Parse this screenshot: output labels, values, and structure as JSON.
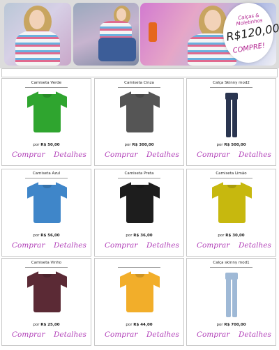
{
  "banner": {
    "promo_small": "Calças & Moletinhos",
    "promo_price": "R$120,00",
    "promo_cta": "COMPRE!"
  },
  "products": [
    {
      "name": "Camiseta Verde",
      "price_prefix": "por",
      "price": "R$ 50,00",
      "kind": "tshirt",
      "color": "#2fa52f",
      "buy_label": "Comprar",
      "details_label": "Detalhes"
    },
    {
      "name": "Camiseta Cinza",
      "price_prefix": "por",
      "price": "R$ 300,00",
      "kind": "tshirt",
      "color": "#555555",
      "buy_label": "Comprar",
      "details_label": "Detalhes"
    },
    {
      "name": "Calça Skinny mod2",
      "price_prefix": "por",
      "price": "R$ 500,00",
      "kind": "pants",
      "color": "#2a3550",
      "buy_label": "Comprar",
      "details_label": "Detalhes"
    },
    {
      "name": "Camiseta Azul",
      "price_prefix": "por",
      "price": "R$ 56,00",
      "kind": "tshirt",
      "color": "#3f86c9",
      "buy_label": "Comprar",
      "details_label": "Detalhes"
    },
    {
      "name": "Camiseta Preta",
      "price_prefix": "por",
      "price": "R$ 36,00",
      "kind": "tshirt",
      "color": "#1d1d1d",
      "buy_label": "Comprar",
      "details_label": "Detalhes"
    },
    {
      "name": "Camiseta Limão",
      "price_prefix": "por",
      "price": "R$ 30,00",
      "kind": "tshirt",
      "color": "#c7b80e",
      "buy_label": "Comprar",
      "details_label": "Detalhes"
    },
    {
      "name": "Camiseta Vinho",
      "price_prefix": "por",
      "price": "R$ 25,00",
      "kind": "tshirt",
      "color": "#5b2a35",
      "buy_label": "Comprar",
      "details_label": "Detalhes"
    },
    {
      "name": "",
      "price_prefix": "por",
      "price": "R$ 44,00",
      "kind": "tshirt",
      "color": "#f2ae2a",
      "buy_label": "Comprar",
      "details_label": "Detalhes"
    },
    {
      "name": "Calça skinny mod1",
      "price_prefix": "por",
      "price": "R$ 700,00",
      "kind": "pants",
      "color": "#9fb9d6",
      "buy_label": "Comprar",
      "details_label": "Detalhes"
    }
  ]
}
